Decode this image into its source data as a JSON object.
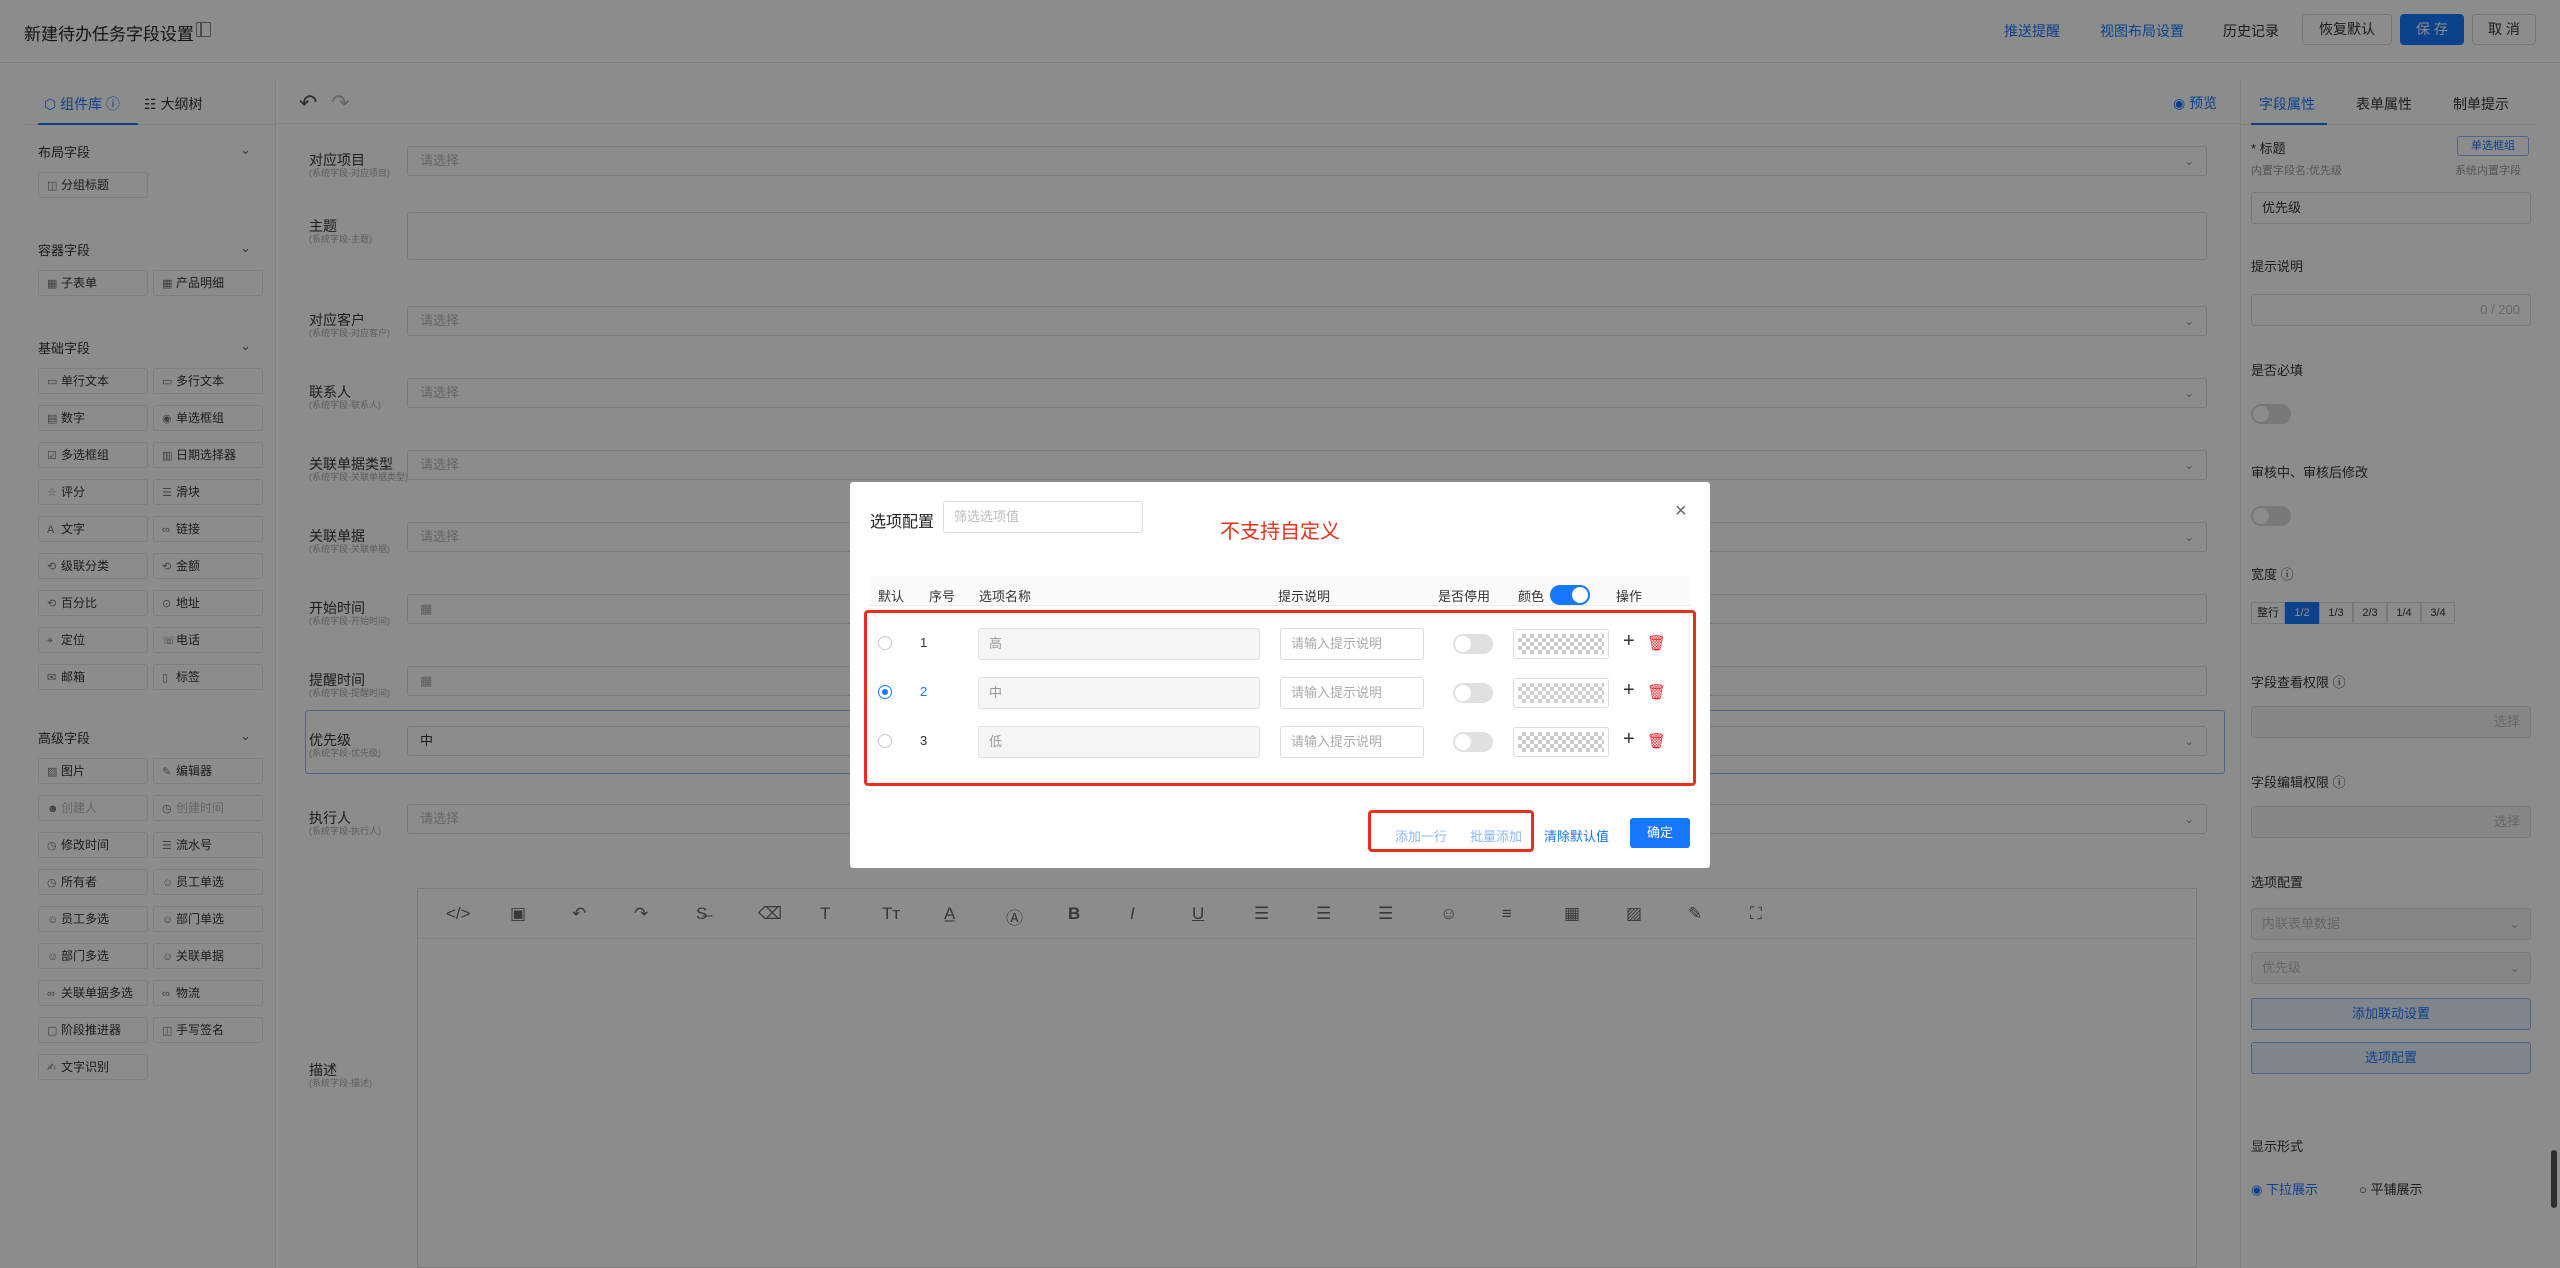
{
  "header": {
    "title": "新建待办任务字段设置",
    "push_reminder": "推送提醒",
    "view_layout": "视图布局设置",
    "history": "历史记录",
    "restore_default": "恢复默认",
    "save": "保 存",
    "cancel": "取 消"
  },
  "left_panel": {
    "tab_components": "组件库",
    "tab_outline": "大纲树",
    "sections": [
      {
        "title": "布局字段",
        "items": [
          "分组标题"
        ]
      },
      {
        "title": "容器字段",
        "items": [
          "子表单",
          "产品明细"
        ]
      },
      {
        "title": "基础字段",
        "items": [
          "单行文本",
          "多行文本",
          "数字",
          "单选框组",
          "多选框组",
          "日期选择器",
          "评分",
          "滑块",
          "文字",
          "链接",
          "级联分类",
          "金额",
          "百分比",
          "地址",
          "定位",
          "电话",
          "邮箱",
          "标签"
        ]
      },
      {
        "title": "高级字段",
        "items": [
          "图片",
          "编辑器",
          "创建人",
          "创建时间",
          "修改时间",
          "流水号",
          "所有者",
          "员工单选",
          "员工多选",
          "部门单选",
          "部门多选",
          "关联单据",
          "关联单据多选",
          "物流",
          "阶段推进器",
          "手写签名",
          "文字识别"
        ]
      }
    ]
  },
  "canvas": {
    "preview": "预览",
    "fields": [
      {
        "label": "对应项目",
        "sub": "(系统字段-对应项目)",
        "placeholder": "请选择"
      },
      {
        "label": "主题",
        "sub": "(系统字段-主题)",
        "placeholder": ""
      },
      {
        "label": "对应客户",
        "sub": "(系统字段-对应客户)",
        "placeholder": "请选择"
      },
      {
        "label": "联系人",
        "sub": "(系统字段-联系人)",
        "placeholder": "请选择"
      },
      {
        "label": "关联单据类型",
        "sub": "(系统字段-关联单据类型)",
        "placeholder": "请选择"
      },
      {
        "label": "关联单据",
        "sub": "(系统字段-关联单据)",
        "placeholder": "请选择"
      },
      {
        "label": "开始时间",
        "sub": "(系统字段-开始时间)",
        "placeholder": ""
      },
      {
        "label": "提醒时间",
        "sub": "(系统字段-提醒时间)",
        "placeholder": ""
      },
      {
        "label": "优先级",
        "sub": "(系统字段-优先级)",
        "placeholder": "中"
      },
      {
        "label": "执行人",
        "sub": "(系统字段-执行人)",
        "placeholder": "请选择"
      },
      {
        "label": "描述",
        "sub": "(系统字段-描述)",
        "placeholder": ""
      }
    ]
  },
  "right_panel": {
    "tabs": [
      "字段属性",
      "表单属性",
      "制单提示"
    ],
    "title_label": "标题",
    "type_badge": "单选框组",
    "builtin_name": "内置字段名:优先级",
    "builtin_tag": "系统内置字段",
    "title_value": "优先级",
    "tip_label": "提示说明",
    "tip_count": "0 / 200",
    "required_label": "是否必填",
    "review_label": "审核中、审核后修改",
    "width_label": "宽度",
    "widths": [
      "整行",
      "1/2",
      "1/3",
      "2/3",
      "1/4",
      "3/4"
    ],
    "view_perm_label": "字段查看权限",
    "select": "选择",
    "edit_perm_label": "字段编辑权限",
    "options_label": "选项配置",
    "options_source": "内联表单数据",
    "options_field": "优先级",
    "add_linkage": "添加联动设置",
    "options_config": "选项配置",
    "display_label": "显示形式",
    "display_dropdown": "下拉展示",
    "display_flat": "平铺展示"
  },
  "modal": {
    "title": "选项配置",
    "filter_placeholder": "筛选选项值",
    "note": "不支持自定义",
    "headers": [
      "默认",
      "序号",
      "选项名称",
      "提示说明",
      "是否停用",
      "颜色",
      "操作"
    ],
    "rows": [
      {
        "index": "1",
        "name": "高",
        "tip_placeholder": "请输入提示说明",
        "default": false
      },
      {
        "index": "2",
        "name": "中",
        "tip_placeholder": "请输入提示说明",
        "default": true
      },
      {
        "index": "3",
        "name": "低",
        "tip_placeholder": "请输入提示说明",
        "default": false
      }
    ],
    "add_row": "添加一行",
    "batch_add": "批量添加",
    "clear_default": "清除默认值",
    "confirm": "确定"
  },
  "colors": {
    "accent": "#1677ff",
    "annotation": "#e8301c"
  }
}
